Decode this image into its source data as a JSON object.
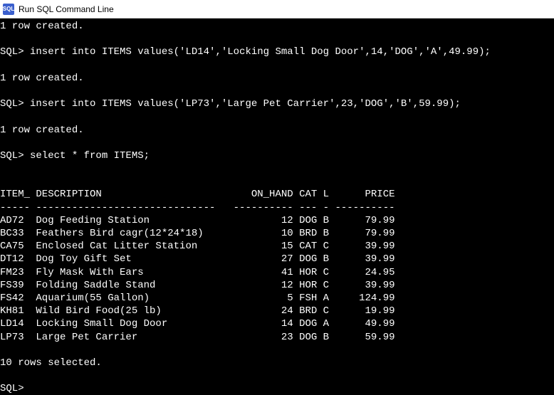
{
  "window": {
    "title": "Run SQL Command Line",
    "icon_text": "SQL"
  },
  "terminal": {
    "lines": [
      "1 row created.",
      "",
      "SQL> insert into ITEMS values('LD14','Locking Small Dog Door',14,'DOG','A',49.99);",
      "",
      "1 row created.",
      "",
      "SQL> insert into ITEMS values('LP73','Large Pet Carrier',23,'DOG','B',59.99);",
      "",
      "1 row created.",
      "",
      "SQL> select * from ITEMS;",
      "",
      "",
      "ITEM_ DESCRIPTION                         ON_HAND CAT L      PRICE",
      "----- ------------------------------   ---------- --- - ----------",
      "AD72  Dog Feeding Station                      12 DOG B      79.99",
      "BC33  Feathers Bird cagr(12*24*18)             10 BRD B      79.99",
      "CA75  Enclosed Cat Litter Station              15 CAT C      39.99",
      "DT12  Dog Toy Gift Set                         27 DOG B      39.99",
      "FM23  Fly Mask With Ears                       41 HOR C      24.95",
      "FS39  Folding Saddle Stand                     12 HOR C      39.99",
      "FS42  Aquarium(55 Gallon)                       5 FSH A     124.99",
      "KH81  Wild Bird Food(25 lb)                    24 BRD C      19.99",
      "LD14  Locking Small Dog Door                   14 DOG A      49.99",
      "LP73  Large Pet Carrier                        23 DOG B      59.99",
      "",
      "10 rows selected.",
      "",
      "SQL>"
    ]
  },
  "chart_data": {
    "type": "table",
    "title": "ITEMS",
    "columns": [
      "ITEM_",
      "DESCRIPTION",
      "ON_HAND",
      "CAT",
      "L",
      "PRICE"
    ],
    "rows": [
      {
        "ITEM_": "AD72",
        "DESCRIPTION": "Dog Feeding Station",
        "ON_HAND": 12,
        "CAT": "DOG",
        "L": "B",
        "PRICE": 79.99
      },
      {
        "ITEM_": "BC33",
        "DESCRIPTION": "Feathers Bird cagr(12*24*18)",
        "ON_HAND": 10,
        "CAT": "BRD",
        "L": "B",
        "PRICE": 79.99
      },
      {
        "ITEM_": "CA75",
        "DESCRIPTION": "Enclosed Cat Litter Station",
        "ON_HAND": 15,
        "CAT": "CAT",
        "L": "C",
        "PRICE": 39.99
      },
      {
        "ITEM_": "DT12",
        "DESCRIPTION": "Dog Toy Gift Set",
        "ON_HAND": 27,
        "CAT": "DOG",
        "L": "B",
        "PRICE": 39.99
      },
      {
        "ITEM_": "FM23",
        "DESCRIPTION": "Fly Mask With Ears",
        "ON_HAND": 41,
        "CAT": "HOR",
        "L": "C",
        "PRICE": 24.95
      },
      {
        "ITEM_": "FS39",
        "DESCRIPTION": "Folding Saddle Stand",
        "ON_HAND": 12,
        "CAT": "HOR",
        "L": "C",
        "PRICE": 39.99
      },
      {
        "ITEM_": "FS42",
        "DESCRIPTION": "Aquarium(55 Gallon)",
        "ON_HAND": 5,
        "CAT": "FSH",
        "L": "A",
        "PRICE": 124.99
      },
      {
        "ITEM_": "KH81",
        "DESCRIPTION": "Wild Bird Food(25 lb)",
        "ON_HAND": 24,
        "CAT": "BRD",
        "L": "C",
        "PRICE": 19.99
      },
      {
        "ITEM_": "LD14",
        "DESCRIPTION": "Locking Small Dog Door",
        "ON_HAND": 14,
        "CAT": "DOG",
        "L": "A",
        "PRICE": 49.99
      },
      {
        "ITEM_": "LP73",
        "DESCRIPTION": "Large Pet Carrier",
        "ON_HAND": 23,
        "CAT": "DOG",
        "L": "B",
        "PRICE": 59.99
      }
    ]
  }
}
